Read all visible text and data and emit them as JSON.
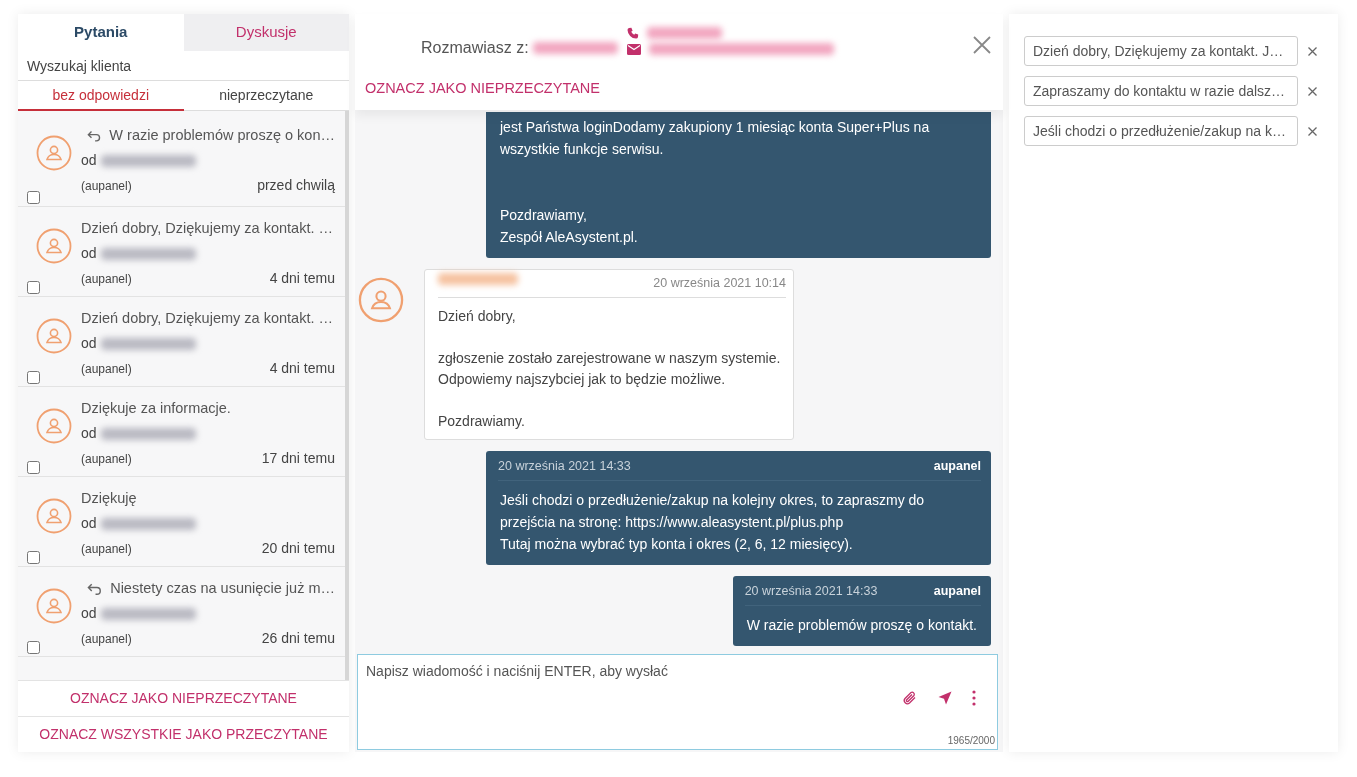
{
  "tabs": [
    {
      "label": "Pytania",
      "selected": true
    },
    {
      "label": "Dyskusje",
      "selected": false
    }
  ],
  "search": {
    "placeholder": "Wyszukaj klienta"
  },
  "filters": [
    {
      "label": "bez odpowiedzi",
      "selected": true
    },
    {
      "label": "nieprzeczytane",
      "selected": false
    }
  ],
  "threads": [
    {
      "preview": "W razie problemów proszę o kon…",
      "replied": true,
      "from_label": "od",
      "name_redacted": true,
      "source": "(aupanel)",
      "time": "przed chwilą",
      "checked": false
    },
    {
      "preview": "Dzień dobry, Dziękujemy za kontakt. …",
      "replied": false,
      "from_label": "od",
      "name_redacted": true,
      "source": "(aupanel)",
      "time": "4 dni temu",
      "checked": false
    },
    {
      "preview": "Dzień dobry, Dziękujemy za kontakt. …",
      "replied": false,
      "from_label": "od",
      "name_redacted": true,
      "source": "(aupanel)",
      "time": "4 dni temu",
      "checked": false
    },
    {
      "preview": "Dziękuje za informacje.",
      "replied": false,
      "from_label": "od",
      "name_redacted": true,
      "source": "(aupanel)",
      "time": "17 dni temu",
      "checked": false
    },
    {
      "preview": "Dziękuję",
      "replied": false,
      "from_label": "od",
      "name_redacted": true,
      "source": "(aupanel)",
      "time": "20 dni temu",
      "checked": false
    },
    {
      "preview": "Niestety czas na usunięcie już m…",
      "replied": true,
      "from_label": "od",
      "name_redacted": true,
      "source": "(aupanel)",
      "time": "26 dni temu",
      "checked": false
    }
  ],
  "list_actions": [
    "OZNACZ JAKO NIEPRZECZYTANE",
    "OZNACZ WSZYSTKIE JAKO PRZECZYTANE"
  ],
  "chat": {
    "header": {
      "label": "Rozmawiasz z:",
      "name_redacted": true,
      "phone_redacted": true,
      "email_redacted": true,
      "action": "OZNACZ JAKO NIEPRZECZYTANE"
    },
    "messages": [
      {
        "kind": "outgoing",
        "text": "jest Państwa loginDodamy zakupiony 1 miesiąc konta Super+Plus na wszystkie funkcje serwisu.\n\n\nPozdrawiamy,\nZespół AleAsystent.pl."
      },
      {
        "kind": "incoming",
        "sender_redacted": true,
        "time": "20 września 2021 10:14",
        "text": "Dzień dobry,\n\nzgłoszenie zostało zarejestrowane w naszym systemie.\nOdpowiemy najszybciej jak to będzie możliwe.\n\nPozdrawiamy."
      },
      {
        "kind": "outgoing",
        "time": "20 września 2021 14:33",
        "author": "aupanel",
        "text": "Jeśli chodzi o przedłużenie/zakup na kolejny okres, to zapraszmy do przejścia na stronę: https://www.aleasystent.pl/plus.php\nTutaj można wybrać typ konta i okres (2, 6, 12 miesięcy)."
      },
      {
        "kind": "outgoing",
        "time": "20 września 2021 14:33",
        "author": "aupanel",
        "text": "W razie problemów proszę o kontakt."
      }
    ],
    "composer": {
      "placeholder": "Napisz wiadomość i naciśnij ENTER, aby wysłać",
      "counter": "1965/2000"
    }
  },
  "templates": [
    {
      "text": "Dzień dobry, Dziękujemy za kontakt. J…"
    },
    {
      "text": "Zapraszamy do kontaktu w razie dalsz…"
    },
    {
      "text": "Jeśli chodzi o przedłużenie/zakup na k…"
    }
  ]
}
